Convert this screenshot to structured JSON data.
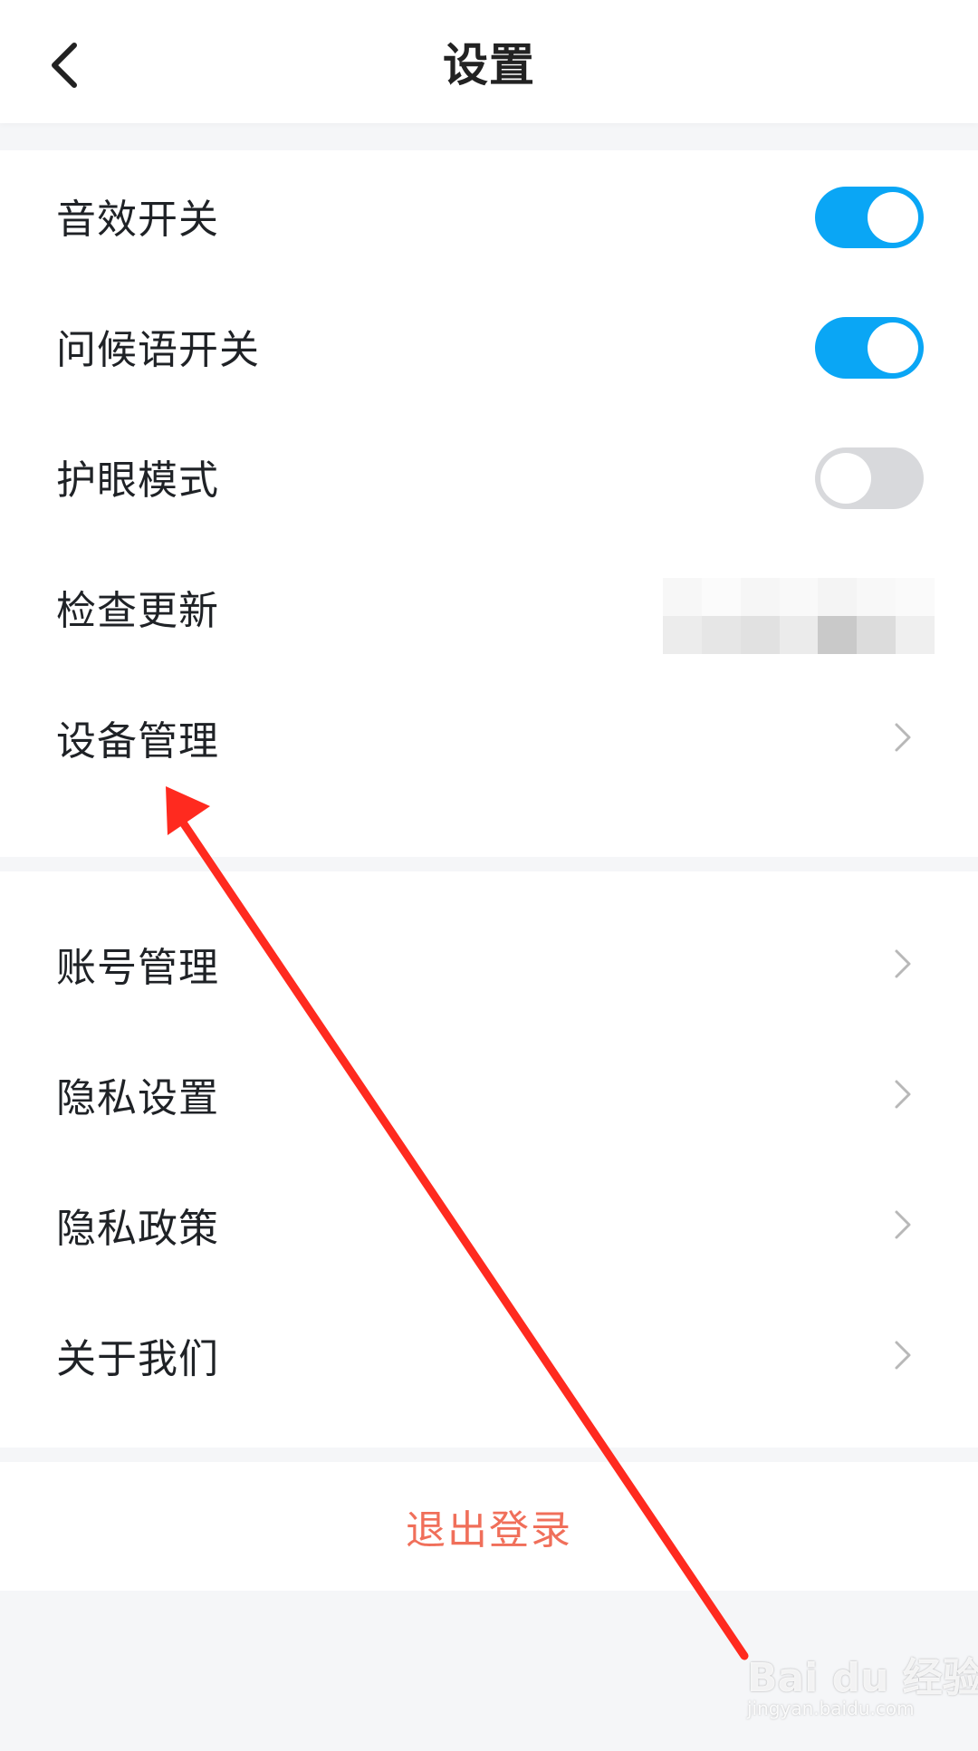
{
  "header": {
    "title": "设置"
  },
  "section_1": {
    "items": [
      {
        "label": "音效开关",
        "control": "toggle",
        "state": "on"
      },
      {
        "label": "问候语开关",
        "control": "toggle",
        "state": "on"
      },
      {
        "label": "护眼模式",
        "control": "toggle",
        "state": "off"
      },
      {
        "label": "检查更新",
        "control": "version-redacted"
      },
      {
        "label": "设备管理",
        "control": "chevron"
      }
    ]
  },
  "section_2": {
    "items": [
      {
        "label": "账号管理",
        "control": "chevron"
      },
      {
        "label": "隐私设置",
        "control": "chevron"
      },
      {
        "label": "隐私政策",
        "control": "chevron"
      },
      {
        "label": "关于我们",
        "control": "chevron"
      }
    ]
  },
  "logout": {
    "label": "退出登录"
  },
  "colors": {
    "toggle_on": "#0aa6f5",
    "toggle_off": "#d8d9dc",
    "logout": "#f06f5a",
    "annotation_arrow": "#ff2a1f",
    "background": "#f5f6f8"
  },
  "icons": {
    "back": "back-chevron-icon",
    "row_chevron": "chevron-right-icon"
  },
  "watermark": {
    "brand": "Bai du 经验",
    "url": "jingyan.baidu.com"
  }
}
